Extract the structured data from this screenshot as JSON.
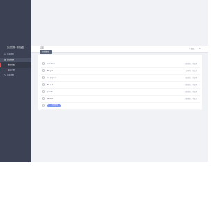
{
  "sidebar": {
    "brand": "[后台管理 · 模块设置]",
    "items": [
      {
        "icon": "home-icon",
        "glyph": "⌂",
        "label": "系统首页"
      },
      {
        "icon": "grid-icon",
        "glyph": "▦",
        "label": "模块管理"
      },
      {
        "icon": "",
        "glyph": "",
        "label": "模块列表"
      },
      {
        "icon": "",
        "glyph": "",
        "label": "模块设置"
      },
      {
        "icon": "wrench-icon",
        "glyph": "✎",
        "label": "系统设置"
      }
    ]
  },
  "topbar": {
    "breadcrumb": "首页",
    "user_label": "退出",
    "settings_glyph": "⚙"
  },
  "card": {
    "action_button": "新增模块",
    "rows": [
      {
        "name": "canvas ui",
        "status": "系统模块，可配置"
      },
      {
        "name": "Bing.ai",
        "status": "已禁用，可启用"
      },
      {
        "name": "on-page-ui",
        "status": "系统模块，可配置"
      },
      {
        "name": "Ex-ui-1",
        "status": "系统模块，可配置"
      },
      {
        "name": "panelUI",
        "status": "系统模块，可配置"
      },
      {
        "name": "Rempix",
        "status": "系统模块，可配置"
      }
    ],
    "add_row_button": "+ 添加模块"
  },
  "colors": {
    "sidebar_bg": "#3c4253",
    "accent_red": "#e34b57",
    "add_button": "#7d97f0",
    "action_button": "#5a6478"
  }
}
